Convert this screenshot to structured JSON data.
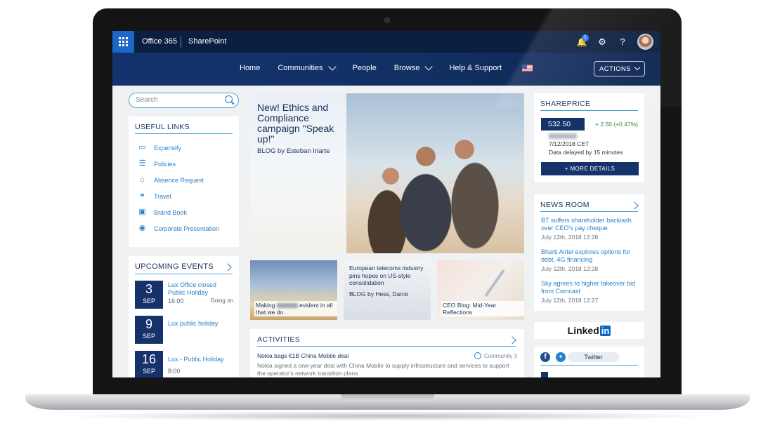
{
  "suite": {
    "app_name": "Office 365",
    "site_name": "SharePoint",
    "notification_count": "1"
  },
  "nav": {
    "items": [
      "Home",
      "Communities",
      "People",
      "Browse",
      "Help & Support"
    ],
    "actions_label": "ACTIONS"
  },
  "search": {
    "placeholder": "Search"
  },
  "useful_links": {
    "title": "USEFUL LINKS",
    "items": [
      "Expensify",
      "Policies",
      "Absence Request",
      "Travel",
      "Brand Book",
      "Corporate Presentation"
    ]
  },
  "upcoming_events": {
    "title": "UPCOMING EVENTS",
    "events": [
      {
        "day": "3",
        "month": "SEP",
        "title": "Lux Office closed Public Holiday",
        "time": "16:00",
        "note": "Going on"
      },
      {
        "day": "9",
        "month": "SEP",
        "title": "Lux public holiday",
        "time": "",
        "note": ""
      },
      {
        "day": "16",
        "month": "SEP",
        "title": "Lux - Public Holiday",
        "time": "8:00",
        "note": ""
      }
    ]
  },
  "hero": {
    "title": "New! Ethics and Compliance campaign \"Speak up!\"",
    "subtitle": "BLOG by Esteban Iriarte"
  },
  "tiles": [
    {
      "caption_pre": "Making",
      "caption_post": "evident in all that we do"
    },
    {
      "title": "European telecoms industry pins hopes on US-style consolidation",
      "subtitle": "BLOG by Hess, Darce"
    },
    {
      "caption": "CEO Blog: Mid-Year Reflections"
    }
  ],
  "activities": {
    "title": "ACTIVITIES",
    "headline": "Nokia bags €1B China Mobile deal",
    "community": "Community 3",
    "body": "Nokia signed a one-year deal with China Mobile to supply infrastructure and services to support the operator's network transition plans"
  },
  "shareprice": {
    "title": "SHAREPRICE",
    "price": "532.50",
    "change": "+ 2.50 (+0.47%)",
    "date": "7/12/2018 CET",
    "delay": "Data delayed by 15 minutes",
    "more_label": "+ MORE DETAILS"
  },
  "news_room": {
    "title": "NEWS ROOM",
    "items": [
      {
        "title": "BT suffers shareholder backlash over CEO's pay cheque",
        "date": "July 12th, 2018 12:28"
      },
      {
        "title": "Bharti Airtel explores options for debt, 4G financing",
        "date": "July 12th, 2018 12:28"
      },
      {
        "title": "Sky agrees to higher takeover bid from Comcast",
        "date": "July 12th, 2018 12:27"
      }
    ]
  },
  "linkedin": {
    "brand_text": "Linked",
    "brand_box": "in"
  },
  "social": {
    "twitter_label": "Twitter"
  },
  "colors": {
    "suite_bar": "#0b1f40",
    "nav_bar": "#14336e",
    "accent": "#2b82c9",
    "navy": "#16326a",
    "positive": "#2e8a3e"
  }
}
